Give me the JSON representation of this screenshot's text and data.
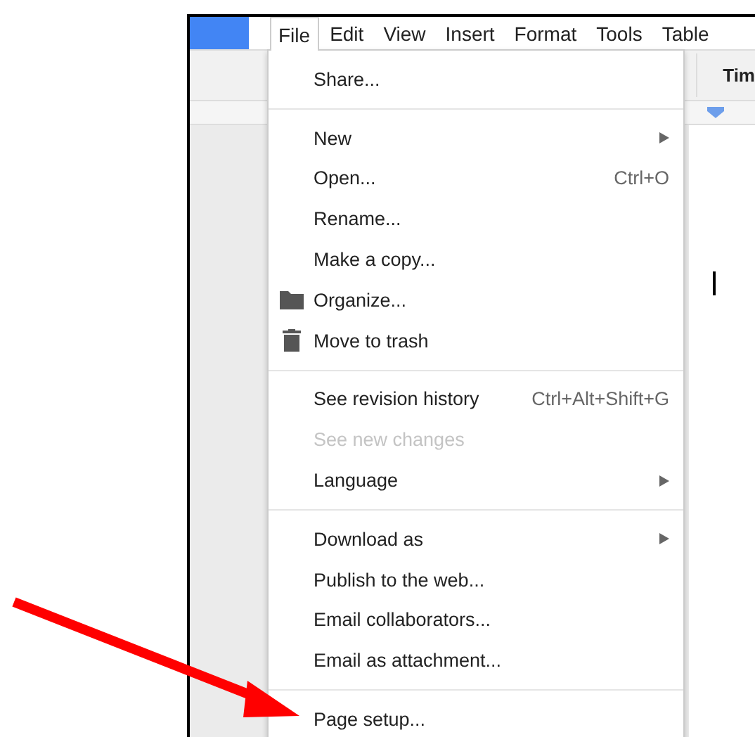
{
  "menu_bar": [
    {
      "label": "File",
      "selected": true
    },
    {
      "label": "Edit",
      "selected": false
    },
    {
      "label": "View",
      "selected": false
    },
    {
      "label": "Insert",
      "selected": false
    },
    {
      "label": "Format",
      "selected": false
    },
    {
      "label": "Tools",
      "selected": false
    },
    {
      "label": "Table",
      "selected": false
    }
  ],
  "toolbar": {
    "font_field": "Tim"
  },
  "file_menu": {
    "groups": [
      [
        {
          "label": "Share...",
          "disabled": false,
          "submenu": false
        }
      ],
      [
        {
          "label": "New",
          "disabled": false,
          "submenu": true
        },
        {
          "label": "Open...",
          "shortcut": "Ctrl+O",
          "disabled": false,
          "submenu": false
        },
        {
          "label": "Rename...",
          "disabled": false,
          "submenu": false
        },
        {
          "label": "Make a copy...",
          "disabled": false,
          "submenu": false
        },
        {
          "label": "Organize...",
          "kind": "folder",
          "disabled": false,
          "submenu": false
        },
        {
          "label": "Move to trash",
          "kind": "trash",
          "disabled": false,
          "submenu": false
        }
      ],
      [
        {
          "label": "See revision history",
          "shortcut": "Ctrl+Alt+Shift+G",
          "disabled": false,
          "submenu": false
        },
        {
          "label": "See new changes",
          "disabled": true,
          "submenu": false
        },
        {
          "label": "Language",
          "disabled": false,
          "submenu": true
        }
      ],
      [
        {
          "label": "Download as",
          "disabled": false,
          "submenu": true
        },
        {
          "label": "Publish to the web...",
          "disabled": false,
          "submenu": false
        },
        {
          "label": "Email collaborators...",
          "disabled": false,
          "submenu": false
        },
        {
          "label": "Email as attachment...",
          "disabled": false,
          "submenu": false
        }
      ],
      [
        {
          "label": "Page setup...",
          "disabled": false,
          "submenu": false
        }
      ]
    ]
  }
}
